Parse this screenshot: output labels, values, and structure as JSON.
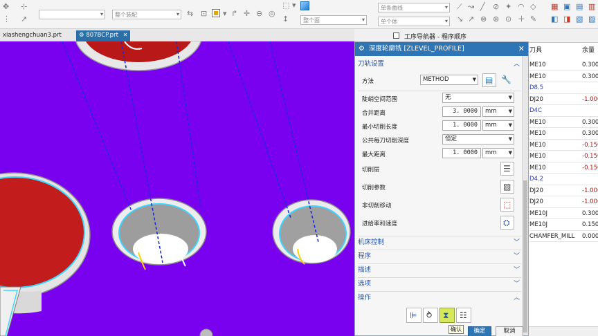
{
  "toolbar": {
    "combo_1": "",
    "combo_2": "整个装配",
    "combo_3": "单条曲线",
    "combo_4": "整个面",
    "combo_5": "单个体"
  },
  "tabs": [
    {
      "label": "xiashengchuan3.prt",
      "active": false
    },
    {
      "label": "807BCP.prt",
      "active": true
    }
  ],
  "navigator": {
    "title": "工序导航器 - 程序顺序",
    "columns": [
      "刀具",
      "余量"
    ],
    "rows": [
      {
        "tool": "ME10",
        "stock": "0.3000"
      },
      {
        "tool": "ME10",
        "stock": "0.3000"
      },
      {
        "tool": "D8.5",
        "stock": ""
      },
      {
        "tool": "DJ20",
        "stock": "-1.000"
      },
      {
        "tool": "D4C",
        "stock": ""
      },
      {
        "tool": "ME10",
        "stock": "0.3000"
      },
      {
        "tool": "ME10",
        "stock": "0.3000"
      },
      {
        "tool": "ME10",
        "stock": "-0.150"
      },
      {
        "tool": "ME10",
        "stock": "-0.150"
      },
      {
        "tool": "ME10",
        "stock": "-0.150"
      },
      {
        "tool": "D4.2",
        "stock": ""
      },
      {
        "tool": "DJ20",
        "stock": "-1.000"
      },
      {
        "tool": "DJ20",
        "stock": "-1.000"
      },
      {
        "tool": "ME10J",
        "stock": "0.3000"
      },
      {
        "tool": "ME10J",
        "stock": "0.150"
      },
      {
        "tool": "CHAMFER_MILL",
        "stock": "0.0000"
      }
    ]
  },
  "dialog": {
    "title": "深度轮廓铣 [ZLEVEL_PROFILE]",
    "sections": {
      "path_settings": "刀轨设置",
      "machine_control": "机床控制",
      "program": "程序",
      "description": "描述",
      "options": "选项",
      "actions": "操作"
    },
    "fields": {
      "method_label": "方法",
      "method_value": "METHOD",
      "steep_label": "陡峭空间范围",
      "steep_value": "无",
      "merge_label": "合并距离",
      "merge_value": "3. 0000",
      "merge_unit": "mm",
      "min_cut_label": "最小切削长度",
      "min_cut_value": "1. 0000",
      "min_cut_unit": "mm",
      "common_depth_label": "公共每刀切削深度",
      "common_depth_value": "恒定",
      "max_dist_label": "最大距离",
      "max_dist_value": "1. 0000",
      "max_dist_unit": "mm"
    },
    "buttons": {
      "cut_levels": "切削层",
      "cut_params": "切削参数",
      "non_cut_moves": "非切削移动",
      "feeds_speeds": "进给率和速度",
      "ok": "确定",
      "cancel": "取消"
    },
    "tooltip": "确认"
  },
  "colors": {
    "viewport_bg": "#7a00f0",
    "title_bar": "#2e75b6",
    "section_text": "#2a58a8"
  }
}
